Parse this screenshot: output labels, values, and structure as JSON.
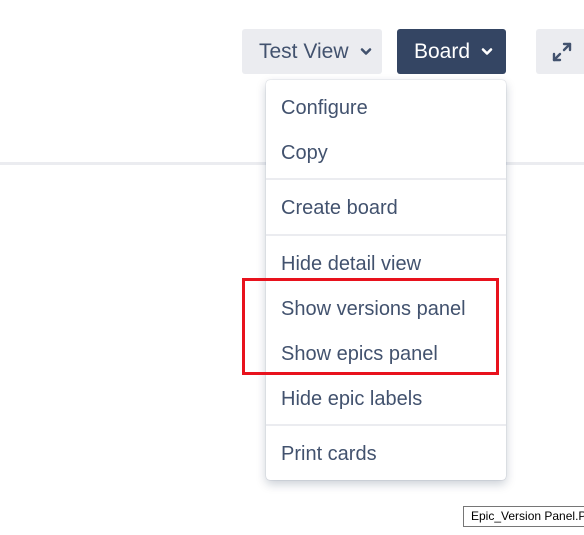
{
  "toolbar": {
    "view_button_label": "Test View",
    "board_button_label": "Board",
    "expand_icon": "expand-arrows-icon",
    "chevron_icon": "chevron-down-icon"
  },
  "board_menu": {
    "items": [
      {
        "label": "Configure"
      },
      {
        "label": "Copy"
      },
      {
        "label": "Create board"
      },
      {
        "label": "Hide detail view"
      },
      {
        "label": "Show versions panel"
      },
      {
        "label": "Show epics panel"
      },
      {
        "label": "Hide epic labels"
      },
      {
        "label": "Print cards"
      }
    ]
  },
  "tooltip": {
    "text": "Epic_Version Panel.PNG"
  },
  "colors": {
    "board_button_bg": "#344563",
    "secondary_button_bg": "#ebecf0",
    "menu_text": "#42526e",
    "highlight_annotation": "#e8121d"
  }
}
